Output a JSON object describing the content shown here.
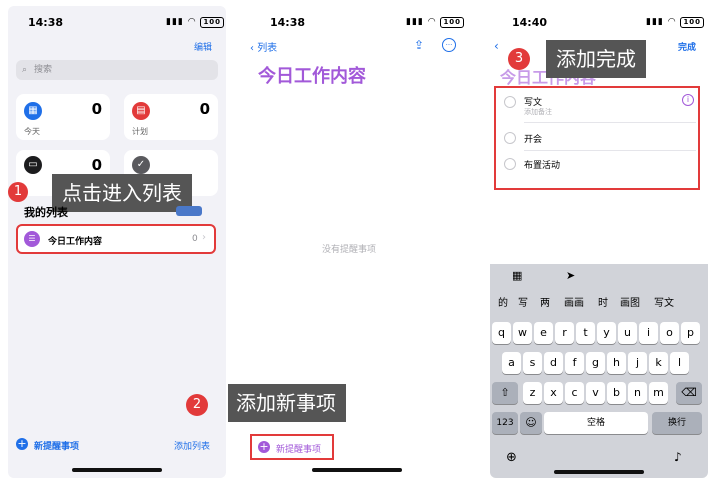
{
  "panel1": {
    "time": "14:38",
    "battery": "100",
    "edit": "编辑",
    "search_placeholder": "搜索",
    "cards": [
      {
        "label": "今天",
        "count": "0",
        "color": "#1f6fe8"
      },
      {
        "label": "计划",
        "count": "0",
        "color": "#e23a3a"
      },
      {
        "label": "全部",
        "count": "0",
        "color": "#1c1c1e"
      },
      {
        "label": "完成",
        "count": "",
        "color": "#5a5a5e"
      }
    ],
    "section_title": "我的列表",
    "list_item": {
      "name": "今日工作内容",
      "count": "0"
    },
    "new_reminder": "新提醒事项",
    "add_list": "添加列表",
    "callout": {
      "step": "1",
      "text": "点击进入列表"
    }
  },
  "panel2": {
    "time": "14:38",
    "battery": "100",
    "back": "列表",
    "title": "今日工作内容",
    "empty_text": "没有提醒事项",
    "new_reminder": "新提醒事项",
    "callout": {
      "step": "2",
      "text": "添加新事项"
    }
  },
  "panel3": {
    "time": "14:40",
    "battery": "100",
    "done": "完成",
    "title": "今日工作内容",
    "items": [
      {
        "title": "写文",
        "note": "添加备注"
      },
      {
        "title": "开会",
        "note": ""
      },
      {
        "title": "布置活动",
        "note": ""
      }
    ],
    "callout": {
      "step": "3",
      "text": "添加完成"
    },
    "keyboard": {
      "suggestions": [
        "的",
        "写",
        "两",
        "画画",
        "时",
        "画图",
        "写文"
      ],
      "row1": [
        "q",
        "w",
        "e",
        "r",
        "t",
        "y",
        "u",
        "i",
        "o",
        "p"
      ],
      "row2": [
        "a",
        "s",
        "d",
        "f",
        "g",
        "h",
        "j",
        "k",
        "l"
      ],
      "row3": [
        "z",
        "x",
        "c",
        "v",
        "b",
        "n",
        "m"
      ],
      "num_key": "123",
      "space_key": "空格",
      "return_key": "换行"
    }
  },
  "colors": {
    "accent": "#1f6fe8",
    "purple": "#a259d9",
    "callout_red": "#e23a3a",
    "callout_bg": "#555555"
  }
}
